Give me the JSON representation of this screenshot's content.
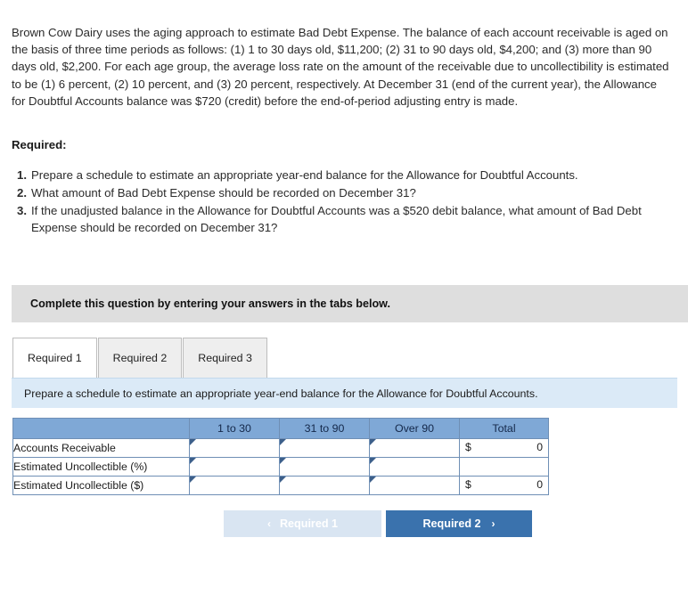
{
  "problem": {
    "text": "Brown Cow Dairy uses the aging approach to estimate Bad Debt Expense. The balance of each account receivable is aged on the basis of three time periods as follows: (1) 1 to 30 days old, $11,200; (2) 31 to 90 days old, $4,200; and (3) more than 90 days old, $2,200. For each age group, the average loss rate on the amount of the receivable due to uncollectibility is estimated to be (1) 6 percent, (2) 10 percent, and (3) 20 percent, respectively. At December 31 (end of the current year), the Allowance for Doubtful Accounts balance was $720 (credit) before the end-of-period adjusting entry is made."
  },
  "required": {
    "heading": "Required:",
    "items": [
      {
        "num": "1.",
        "text": "Prepare a schedule to estimate an appropriate year-end balance for the Allowance for Doubtful Accounts."
      },
      {
        "num": "2.",
        "text": "What amount of Bad Debt Expense should be recorded on December 31?"
      },
      {
        "num": "3.",
        "text": "If the unadjusted balance in the Allowance for Doubtful Accounts was a $520 debit balance, what amount of Bad Debt Expense should be recorded on December 31?"
      }
    ]
  },
  "instruction_bar": {
    "text": "Complete this question by entering your answers in the tabs below.",
    "background": "#dedede"
  },
  "tabs": [
    {
      "label": "Required 1",
      "active": true
    },
    {
      "label": "Required 2",
      "active": false
    },
    {
      "label": "Required 3",
      "active": false
    }
  ],
  "requirement_bar": {
    "text": "Prepare a schedule to estimate an appropriate year-end balance for the Allowance for Doubtful Accounts.",
    "background": "#dbeaf7"
  },
  "schedule_table": {
    "header_background": "#7fa8d6",
    "columns": [
      "",
      "1 to 30",
      "31 to 90",
      "Over 90",
      "Total"
    ],
    "rows": [
      {
        "label": "Accounts Receivable",
        "cells": [
          "",
          "",
          ""
        ],
        "total_symbol": "$",
        "total_value": "0"
      },
      {
        "label": "Estimated Uncollectible (%)",
        "cells": [
          "",
          "",
          ""
        ],
        "total_symbol": "",
        "total_value": ""
      },
      {
        "label": "Estimated Uncollectible ($)",
        "cells": [
          "",
          "",
          ""
        ],
        "total_symbol": "$",
        "total_value": "0"
      }
    ]
  },
  "nav": {
    "prev": {
      "label": "Required 1",
      "chevron": "‹",
      "enabled": false,
      "color": "#d9e5f2"
    },
    "next": {
      "label": "Required 2",
      "chevron": "›",
      "enabled": true,
      "color": "#3a72ad"
    }
  }
}
